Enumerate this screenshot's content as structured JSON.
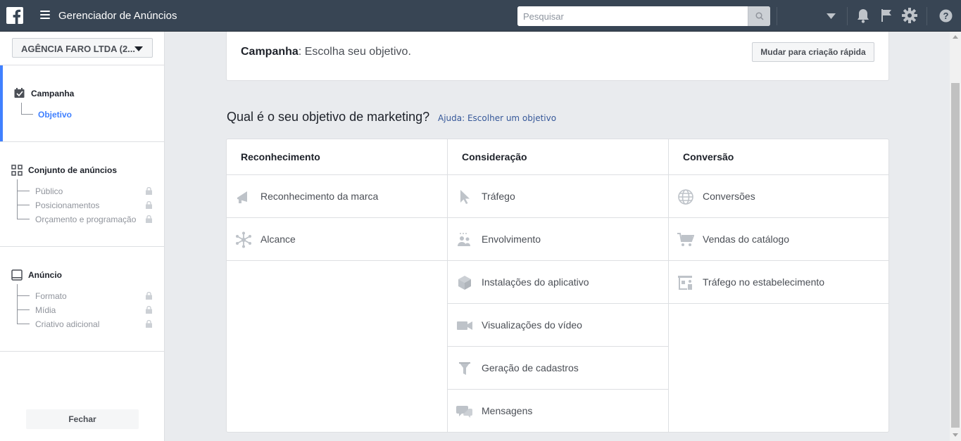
{
  "header": {
    "app_title": "Gerenciador de Anúncios",
    "search_placeholder": "Pesquisar"
  },
  "sidebar": {
    "account": "AGÊNCIA FARO LTDA (2...",
    "campaign": {
      "title": "Campanha",
      "items": [
        {
          "label": "Objetivo",
          "active": true
        }
      ]
    },
    "adset": {
      "title": "Conjunto de anúncios",
      "items": [
        {
          "label": "Público",
          "locked": true
        },
        {
          "label": "Posicionamentos",
          "locked": true
        },
        {
          "label": "Orçamento e programação",
          "locked": true
        }
      ]
    },
    "ad": {
      "title": "Anúncio",
      "items": [
        {
          "label": "Formato",
          "locked": true
        },
        {
          "label": "Mídia",
          "locked": true
        },
        {
          "label": "Criativo adicional",
          "locked": true
        }
      ]
    },
    "close_label": "Fechar"
  },
  "main": {
    "campaign_bold": "Campanha",
    "campaign_rest": ": Escolha seu objetivo.",
    "quick_create_label": "Mudar para criação rápida",
    "question": "Qual é o seu objetivo de marketing?",
    "help_link": "Ajuda: Escolher um objetivo",
    "columns": [
      {
        "title": "Reconhecimento",
        "items": [
          {
            "label": "Reconhecimento da marca",
            "icon": "megaphone-icon"
          },
          {
            "label": "Alcance",
            "icon": "reach-icon"
          }
        ]
      },
      {
        "title": "Consideração",
        "items": [
          {
            "label": "Tráfego",
            "icon": "cursor-icon"
          },
          {
            "label": "Envolvimento",
            "icon": "people-icon"
          },
          {
            "label": "Instalações do aplicativo",
            "icon": "box-icon"
          },
          {
            "label": "Visualizações do vídeo",
            "icon": "video-icon"
          },
          {
            "label": "Geração de cadastros",
            "icon": "funnel-icon"
          },
          {
            "label": "Mensagens",
            "icon": "chat-icon"
          }
        ]
      },
      {
        "title": "Conversão",
        "items": [
          {
            "label": "Conversões",
            "icon": "globe-icon"
          },
          {
            "label": "Vendas do catálogo",
            "icon": "cart-icon"
          },
          {
            "label": "Tráfego no estabelecimento",
            "icon": "store-icon"
          }
        ]
      }
    ]
  },
  "colors": {
    "topbar": "#384554",
    "accent": "#4080ff",
    "link": "#365899",
    "icon": "#bec3c9"
  }
}
